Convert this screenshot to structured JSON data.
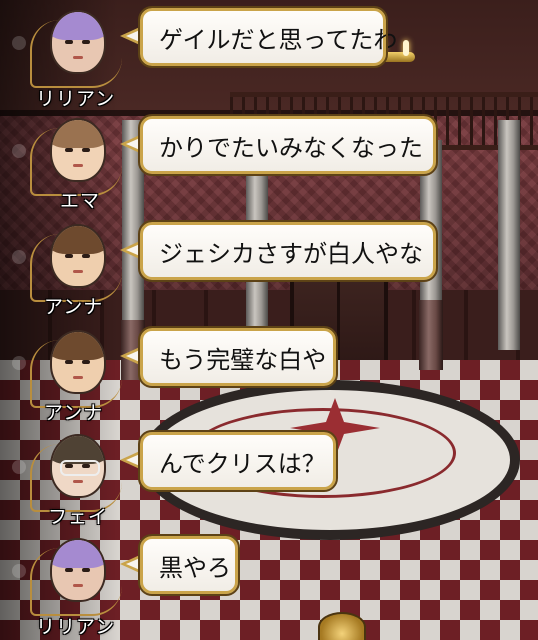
{
  "messages": [
    {
      "speaker": "リリアン",
      "text": "ゲイルだと思ってたわ",
      "hair": "#a58ad0",
      "skin": "#e8c7b2",
      "glasses": false
    },
    {
      "speaker": "エマ",
      "text": "かりでたいみなくなった",
      "hair": "#9a7250",
      "skin": "#f1d3b6",
      "glasses": false
    },
    {
      "speaker": "アンナ",
      "text": "ジェシカさすが白人やな",
      "hair": "#6e4a2e",
      "skin": "#efcfae",
      "glasses": false
    },
    {
      "speaker": "アンナ",
      "text": "もう完璧な白や",
      "hair": "#6e4a2e",
      "skin": "#efcfae",
      "glasses": false
    },
    {
      "speaker": "フェイ",
      "text": "んでクリスは？",
      "hair": "#4f4234",
      "skin": "#efd8c6",
      "glasses": true
    },
    {
      "speaker": "リリアン",
      "text": "黒やろ",
      "hair": "#a58ad0",
      "skin": "#e8c7b2",
      "glasses": false
    }
  ],
  "colors": {
    "bubble_border": "#caa44a",
    "bubble_fill": "#fffdfa",
    "name_text": "#ffffff"
  }
}
